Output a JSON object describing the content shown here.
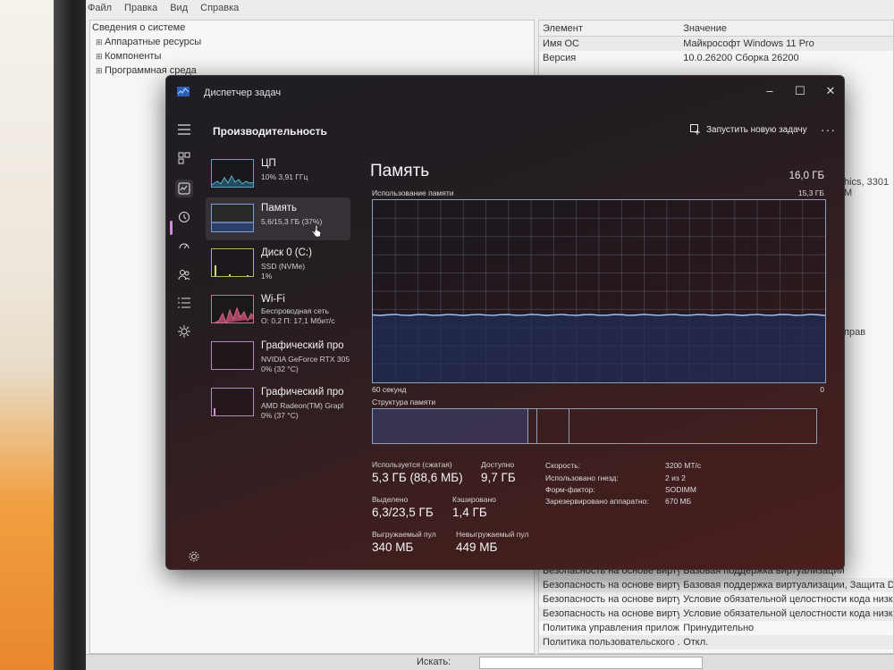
{
  "msinfo": {
    "menu": [
      "Файл",
      "Правка",
      "Вид",
      "Справка"
    ],
    "tree": {
      "root": "Сведения о системе",
      "children": [
        "Аппаратные ресурсы",
        "Компоненты",
        "Программная среда"
      ]
    },
    "table": {
      "headers": [
        "Элемент",
        "Значение"
      ],
      "rows": [
        [
          "Имя ОС",
          "Майкрософт Windows 11 Pro"
        ],
        [
          "Версия",
          "10.0.26200 Сборка 26200"
        ]
      ],
      "bottom_rows": [
        [
          "Безопасность на основе вирту...",
          "Базовая поддержка виртуализации"
        ],
        [
          "Безопасность на основе вирту...",
          "Базовая поддержка виртуализации, Защита DMA, Код U"
        ],
        [
          "Безопасность на основе вирту...",
          "Условие обязательной целостности кода низкоуровнев"
        ],
        [
          "Безопасность на основе вирту...",
          "Условие обязательной целостности кода низкоуровнев"
        ],
        [
          "Политика управления прилож...",
          "Принудительно"
        ],
        [
          "Политика пользовательского ...",
          "Откл."
        ]
      ]
    },
    "fragments": {
      "graphics": "hics, 3301 M",
      "rights": "прав"
    },
    "search_label": "Искать:"
  },
  "tm": {
    "title": "Диспетчер задач",
    "page_header": "Производительность",
    "run_task": "Запустить новую задачу",
    "devices": [
      {
        "name": "ЦП",
        "sub1": "10% 3,91 ГГц",
        "sub2": "",
        "sub3": ""
      },
      {
        "name": "Память",
        "sub1": "5,6/15,3 ГБ (37%)",
        "sub2": "",
        "sub3": ""
      },
      {
        "name": "Диск 0 (C:)",
        "sub1": "SSD (NVMe)",
        "sub2": "1%",
        "sub3": ""
      },
      {
        "name": "Wi-Fi",
        "sub1": "Беспроводная сеть",
        "sub2": "О: 0,2 П: 17,1 Мбит/с",
        "sub3": ""
      },
      {
        "name": "Графический про",
        "sub1": "NVIDIA GeForce RTX 305",
        "sub2": "0% (32 °C)",
        "sub3": ""
      },
      {
        "name": "Графический про",
        "sub1": "AMD Radeon(TM) Grapl",
        "sub2": "0% (37 °C)",
        "sub3": ""
      }
    ],
    "memory": {
      "title": "Память",
      "total": "16,0 ГБ",
      "usage_label": "Использование памяти",
      "usage_max": "15,3 ГБ",
      "usage_fraction": 0.37,
      "time_left": "60 секунд",
      "time_right": "0",
      "structure_label": "Структура памяти",
      "stats": {
        "in_use_label": "Используется (сжатая)",
        "in_use": "5,3 ГБ (88,6 МБ)",
        "available_label": "Доступно",
        "available": "9,7 ГБ",
        "committed_label": "Выделено",
        "committed": "6,3/23,5 ГБ",
        "cached_label": "Кэшировано",
        "cached": "1,4 ГБ",
        "paged_label": "Выгружаемый пул",
        "paged": "340 МБ",
        "nonpaged_label": "Невыгружаемый пул",
        "nonpaged": "449 МБ"
      },
      "specs": [
        [
          "Скорость:",
          "3200 МТ/с"
        ],
        [
          "Использовано гнезд:",
          "2 из 2"
        ],
        [
          "Форм-фактор:",
          "SODIMM"
        ],
        [
          "Зарезервировано аппаратно:",
          "670 МБ"
        ]
      ]
    },
    "colors": {
      "accent": "#d08adf",
      "graph_border": "#8aa0bd",
      "graph_fill": "#1f2e5a"
    }
  }
}
